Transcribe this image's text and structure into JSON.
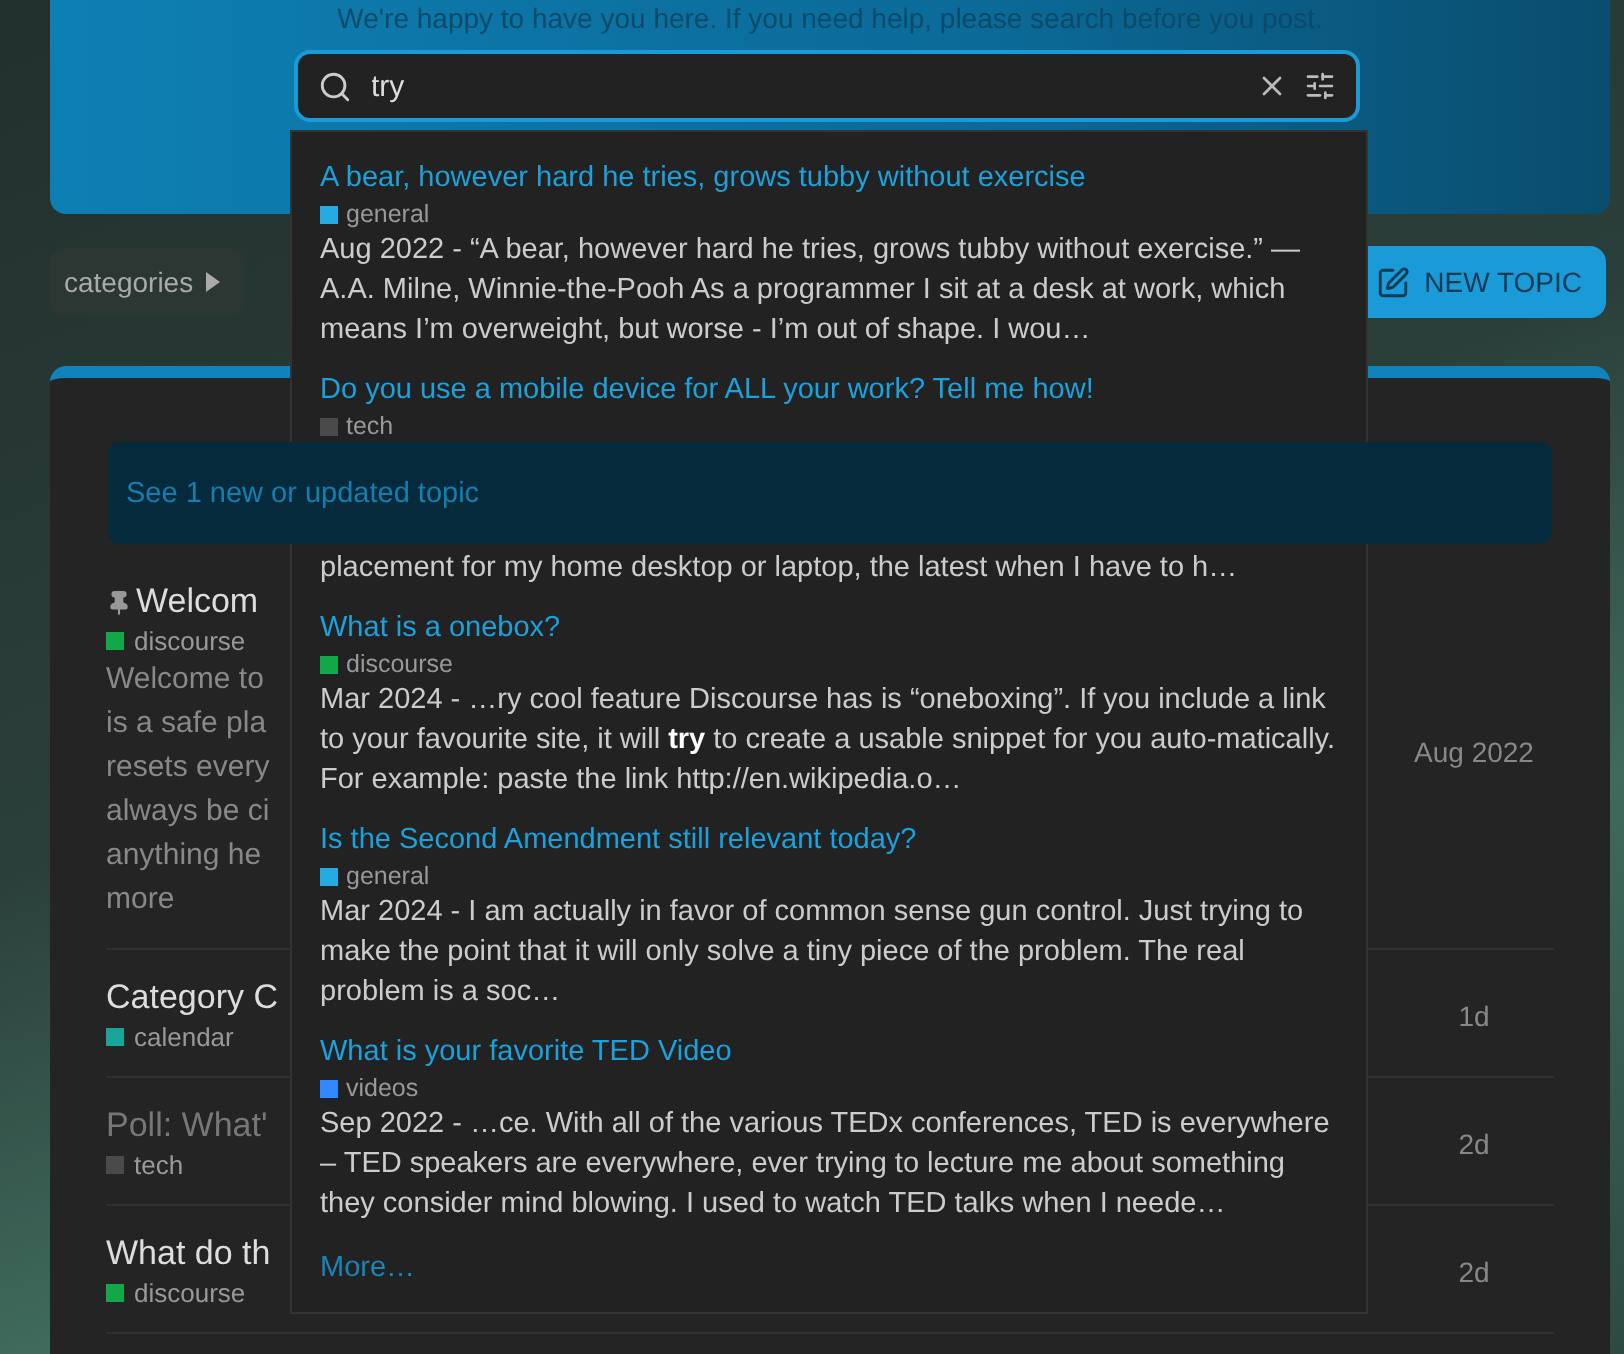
{
  "header": {
    "welcome": "We're happy to have you here. If you need help, please search before you post."
  },
  "search": {
    "value": "try"
  },
  "breadcrumb": {
    "label": "categories"
  },
  "new_topic_button": "NEW TOPIC",
  "new_topics_banner": "See 1 new or updated topic",
  "topics": [
    {
      "title": "Welcom",
      "pinned": true,
      "read": false,
      "tag": {
        "name": "discourse",
        "color": "#12a84a"
      },
      "excerpt_lines": [
        "Welcome to",
        "is a safe pla",
        "resets every",
        "always be ci",
        "anything he",
        "more"
      ],
      "activity": "Aug 2022"
    },
    {
      "title": "Category C",
      "pinned": false,
      "read": false,
      "tag": {
        "name": "calendar",
        "color": "#1aa59b"
      },
      "activity": "1d"
    },
    {
      "title": "Poll: What'",
      "pinned": false,
      "read": true,
      "tag": {
        "name": "tech",
        "color": "#4a4a4a"
      },
      "activity": "2d"
    },
    {
      "title": "What do th",
      "pinned": false,
      "read": false,
      "tag": {
        "name": "discourse",
        "color": "#12a84a"
      },
      "activity": "2d"
    }
  ],
  "results": [
    {
      "title": "A bear, however hard he tries, grows tubby without exercise",
      "tag": {
        "name": "general",
        "color": "#25aae1"
      },
      "covered": false,
      "excerpt": "Aug 2022 - “A bear, however hard he tries, grows tubby without exercise.” — A.A. Milne, Winnie-the-Pooh As a programmer I sit at a desk at work, which means I’m overweight, but worse - I’m out of shape. I wou…"
    },
    {
      "title": "Do you use a mobile device for ALL your work? Tell me how!",
      "tag": {
        "name": "tech",
        "color": "#4a4a4a"
      },
      "covered": true,
      "excerpt": "placement for my home desktop or laptop, the latest when I have to h…"
    },
    {
      "title": "What is a onebox?",
      "tag": {
        "name": "discourse",
        "color": "#12a84a"
      },
      "covered": false,
      "excerpt": "Mar 2024 - …ry cool feature Discourse has is “oneboxing”. If you include a link to your favourite site, it will **try** to create a usable snippet for you auto-matically. For example: paste the link http://en.wikipedia.o…"
    },
    {
      "title": "Is the Second Amendment still relevant today?",
      "tag": {
        "name": "general",
        "color": "#25aae1"
      },
      "covered": false,
      "excerpt": "Mar 2024 - I am actually in favor of common sense gun control. Just trying to make the point that it will only solve a tiny piece of the problem. The real problem is a soc…"
    },
    {
      "title": "What is your favorite TED Video",
      "tag": {
        "name": "videos",
        "color": "#3087ff"
      },
      "covered": false,
      "excerpt": "Sep 2022 - …ce. With all of the various TEDx conferences, TED is everywhere – TED speakers are everywhere, ever trying to lecture me about something they consider mind blowing. I used to watch TED talks when I neede…"
    }
  ],
  "more_link": "More…"
}
